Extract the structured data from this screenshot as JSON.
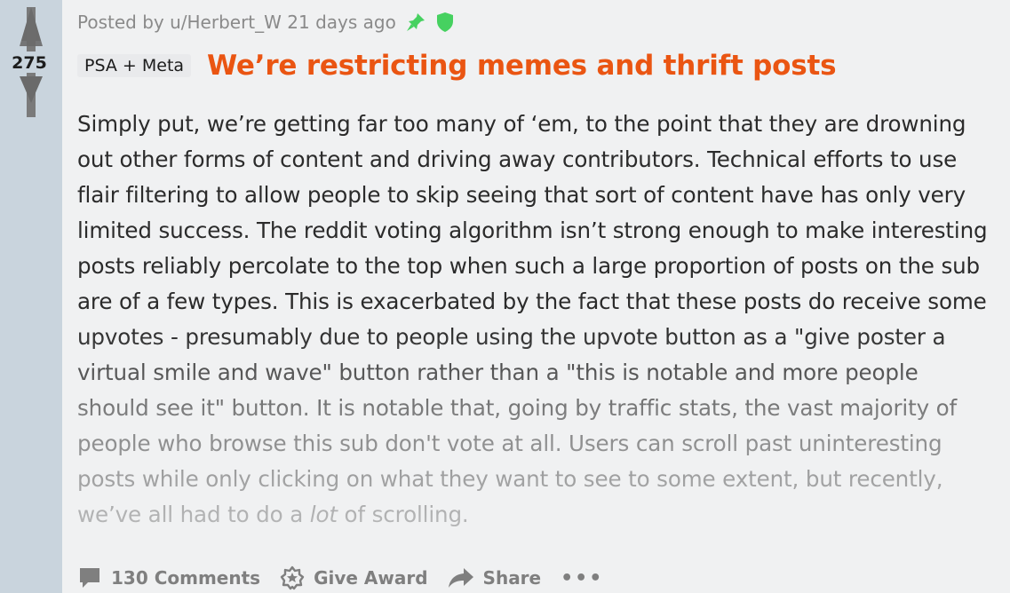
{
  "vote": {
    "score": "275"
  },
  "post": {
    "meta_text": "Posted by u/Herbert_W 21 days ago",
    "flair": "PSA + Meta",
    "title": "We’re restricting memes and thrift posts",
    "body": "Simply put, we’re getting far too many of ‘em, to the point that they are drowning out other forms of content and driving away contributors. Technical efforts to use flair filtering to allow people to skip seeing that sort of content have has only very limited success. The reddit voting algorithm isn’t strong enough to make interesting posts reliably percolate to the top when such a large proportion of posts on the sub are of a few types. This is exacerbated by the fact that these posts do receive some upvotes - presumably due to people using the upvote button as a \"give poster a virtual smile and wave\" button rather than a \"this is notable and more people should see it\" button. It is notable that, going by traffic stats, the vast majority of people who browse this sub don't vote at all. Users can scroll past uninteresting posts while only clicking on what they want to see to some extent, but recently, we’ve all had to do a",
    "body_emphasis": "lot",
    "body_tail": " of scrolling."
  },
  "actions": {
    "comments": "130 Comments",
    "award": "Give Award",
    "share": "Share",
    "more": "•••"
  },
  "colors": {
    "title": "#ea5512",
    "pin": "#46d160",
    "shield": "#46d160",
    "vote_column": "#c9d4dd"
  },
  "icons": [
    "upvote-arrow-icon",
    "downvote-arrow-icon",
    "pin-icon",
    "shield-icon",
    "comment-icon",
    "award-icon",
    "share-icon"
  ]
}
